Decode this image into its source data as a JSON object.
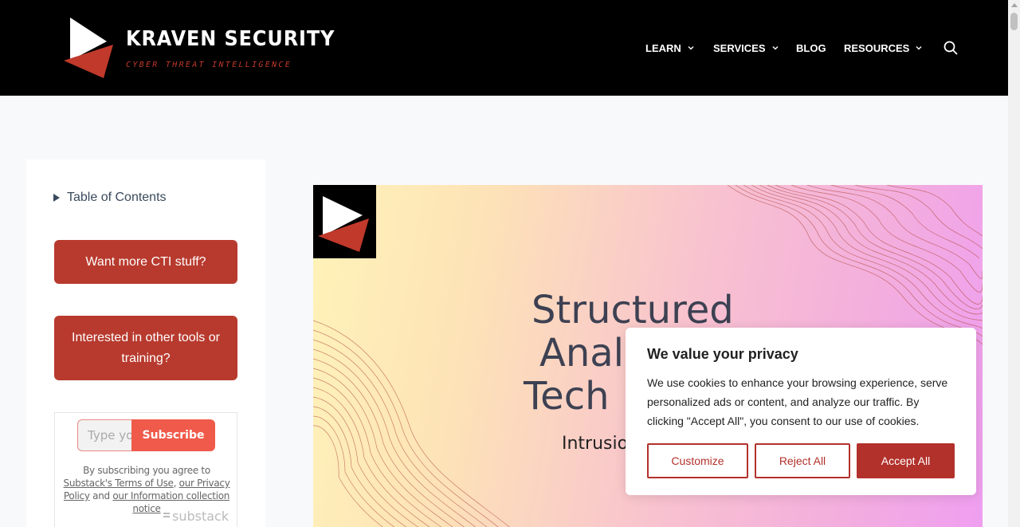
{
  "header": {
    "logo_title": "KRAVEN SECURITY",
    "logo_subtitle": "CYBER THREAT INTELLIGENCE",
    "nav": [
      {
        "label": "LEARN",
        "has_dropdown": true
      },
      {
        "label": "SERVICES",
        "has_dropdown": true
      },
      {
        "label": "BLOG",
        "has_dropdown": false
      },
      {
        "label": "RESOURCES",
        "has_dropdown": true
      }
    ],
    "search_icon": "search-icon"
  },
  "sidebar": {
    "toc_label": "Table of Contents",
    "cta_cti": "Want more CTI stuff?",
    "cta_tools": "Interested in other tools or training?",
    "substack": {
      "input_placeholder": "Type your email...",
      "subscribe_label": "Subscribe",
      "note_prefix": "By subscribing you agree to",
      "terms_link": "Substack's Terms of Use",
      "note_sep1": ",",
      "privacy_link": "our Privacy Policy",
      "note_and": "and",
      "info_link": "our Information collection notice",
      "brand": "substack"
    }
  },
  "hero": {
    "title_line1": "Structured",
    "title_line2": "Anal",
    "title_line3": "Tech",
    "subtitle": "Intrusio"
  },
  "cookie_banner": {
    "title": "We value your privacy",
    "text": "We use cookies to enhance your browsing experience, serve personalized ads or content, and analyze our traffic. By clicking \"Accept All\", you consent to our use of cookies.",
    "customize": "Customize",
    "reject": "Reject All",
    "accept": "Accept All"
  },
  "colors": {
    "brand_red": "#b83a2e",
    "cookie_red": "#b2312b",
    "subscribe_red": "#ef5a4a",
    "header_bg": "#000000"
  }
}
